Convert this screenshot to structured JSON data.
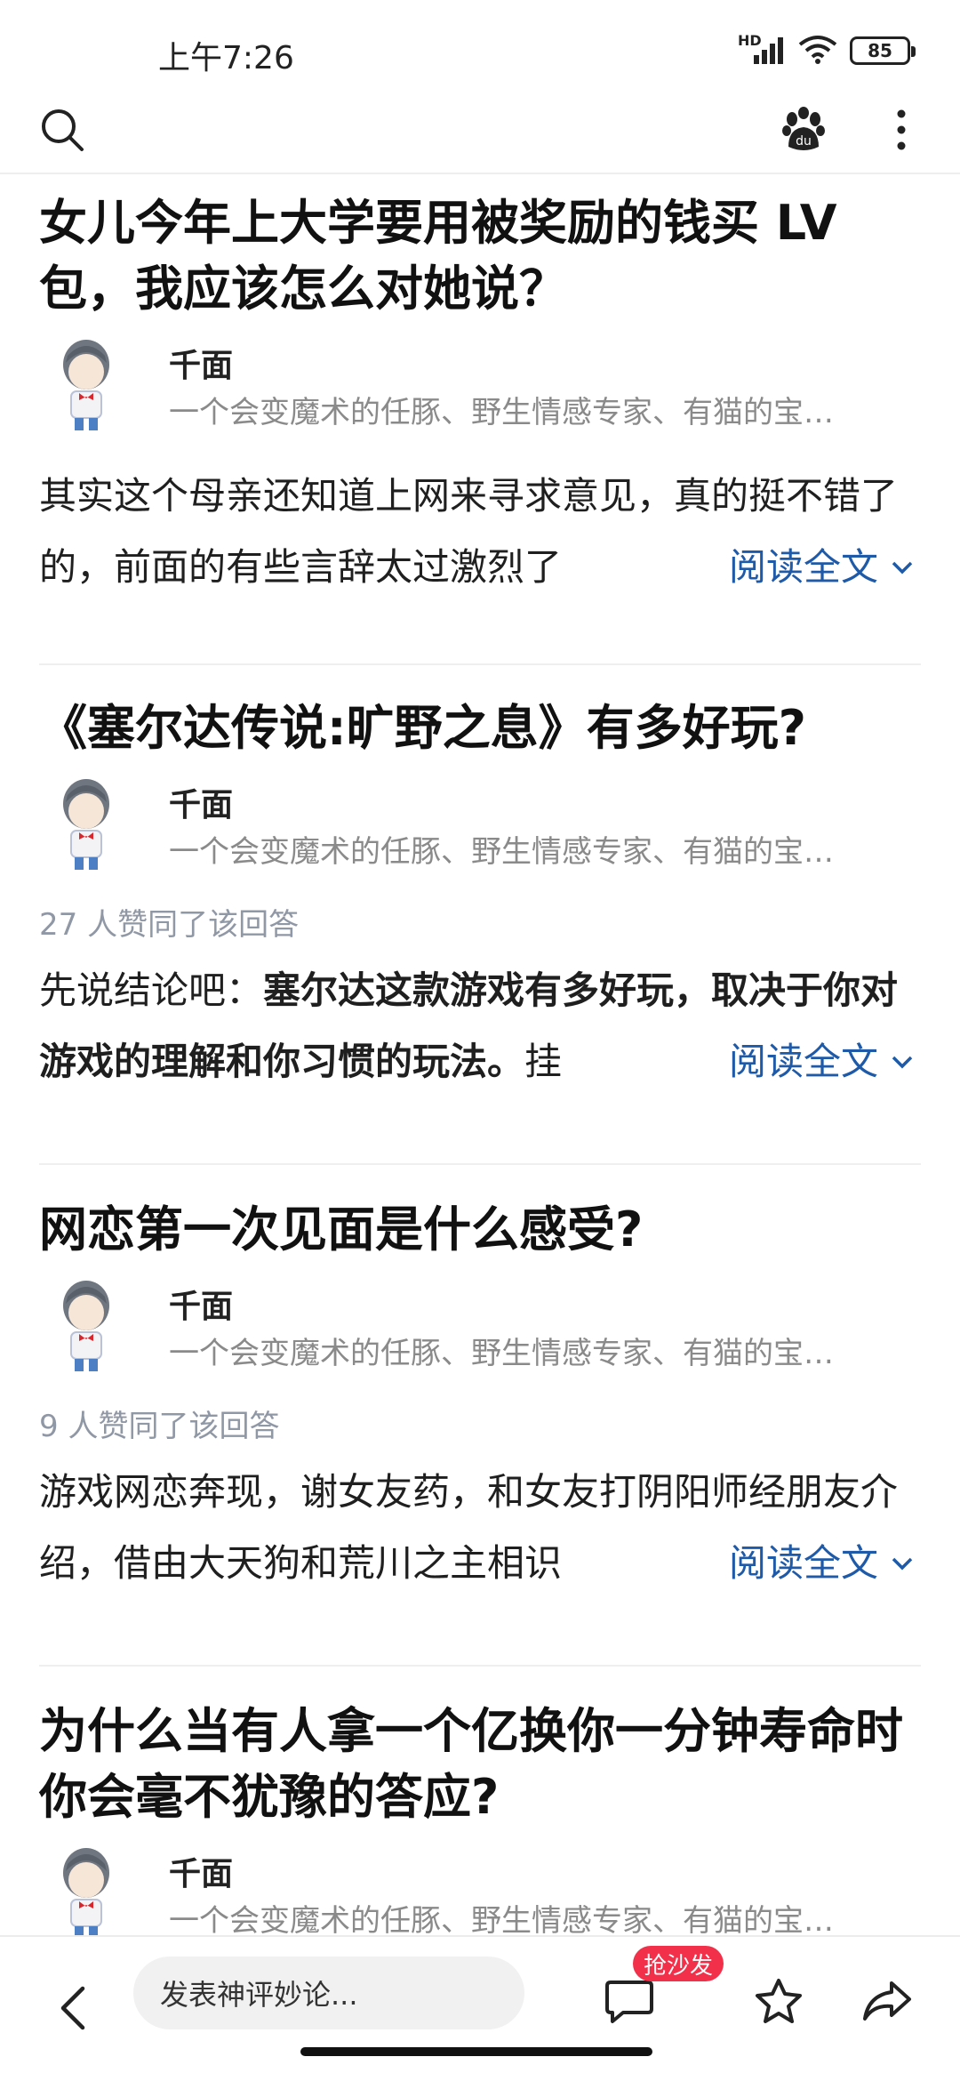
{
  "status_bar": {
    "time": "上午7:26",
    "network_label": "HD",
    "battery": "85"
  },
  "top_bar": {
    "left_icon": "search-icon",
    "right_icons": [
      "baidu-paw-icon",
      "more-vertical-icon"
    ]
  },
  "feed": {
    "cards": [
      {
        "title": "女儿今年上大学要用被奖励的钱买 LV 包，我应该怎么对她说？",
        "author_name": "千面",
        "author_bio": "一个会变魔术的任豚、野生情感专家、有猫的宝…",
        "agree_text": "",
        "excerpt_normal": "其实这个母亲还知道上网来寻求意见，真的挺不错了的，前面的有些言辞太过激烈了",
        "excerpt_bold": "",
        "read_more": "阅读全文"
      },
      {
        "title": "《塞尔达传说:旷野之息》有多好玩?",
        "author_name": "千面",
        "author_bio": "一个会变魔术的任豚、野生情感专家、有猫的宝…",
        "agree_text": "27 人赞同了该回答",
        "excerpt_normal": "先说结论吧：",
        "excerpt_bold": "塞尔达这款游戏有多好玩，取决于你对游戏的理解和你习惯的玩法。",
        "excerpt_tail": "挂",
        "read_more": "阅读全文"
      },
      {
        "title": "网恋第一次见面是什么感受?",
        "author_name": "千面",
        "author_bio": "一个会变魔术的任豚、野生情感专家、有猫的宝…",
        "agree_text": "9 人赞同了该回答",
        "excerpt_normal": "游戏网恋奔现，谢女友药，和女友打阴阳师经朋友介绍，借由大天狗和荒川之主相识",
        "excerpt_bold": "",
        "read_more": "阅读全文"
      },
      {
        "title": "为什么当有人拿一个亿换你一分钟寿命时你会毫不犹豫的答应?",
        "author_name": "千面",
        "author_bio": "一个会变魔术的任豚、野生情感专家、有猫的宝…"
      }
    ]
  },
  "bottom_bar": {
    "back_icon": "chevron-left-icon",
    "comment_placeholder": "发表神评妙论...",
    "sofa_badge": "抢沙发",
    "icons": [
      "comment-icon",
      "star-icon",
      "share-icon"
    ]
  },
  "colors": {
    "link": "#1e5aa8",
    "badge": "#f2304a",
    "muted": "#8a8a8a"
  }
}
